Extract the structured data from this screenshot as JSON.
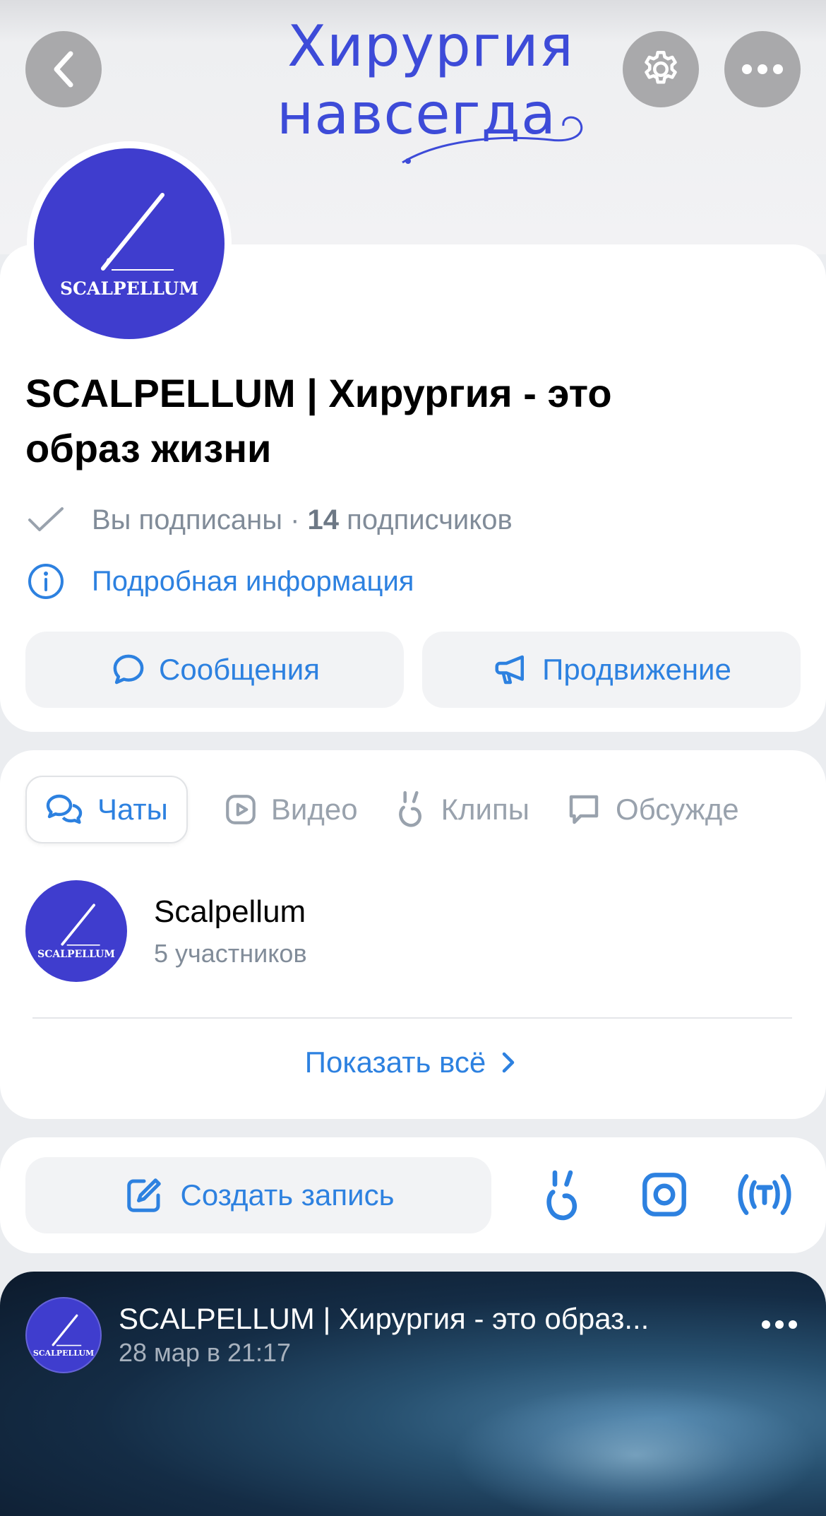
{
  "header": {
    "back_icon": "chevron-left-icon",
    "settings_icon": "gear-icon",
    "more_icon": "more-horizontal-icon",
    "cover_line1": "Хирургия",
    "cover_line2": "навсегда"
  },
  "community": {
    "logo_text": "SCALPELLUM",
    "name_line1": "SCALPELLUM | Хирургия - это",
    "name_line2": "образ жизни",
    "subscribed_text": "Вы подписаны",
    "separator": " · ",
    "subscribers_count": "14",
    "subscribers_label": " подписчиков",
    "info_link": "Подробная информация"
  },
  "actions": {
    "messages_label": "Сообщения",
    "promotion_label": "Продвижение"
  },
  "tabs": [
    {
      "label": "Чаты",
      "icon": "chats-icon",
      "active": true
    },
    {
      "label": "Видео",
      "icon": "video-icon",
      "active": false
    },
    {
      "label": "Клипы",
      "icon": "clips-icon",
      "active": false
    },
    {
      "label": "Обсужде",
      "icon": "discussions-icon",
      "active": false
    }
  ],
  "chat": {
    "logo_text": "SCALPELLUM",
    "name": "Scalpellum",
    "members": "5 участников",
    "show_all": "Показать всё"
  },
  "composer": {
    "create_label": "Создать запись",
    "icons": [
      "clips-icon",
      "instagram-icon",
      "live-stream-icon"
    ]
  },
  "post": {
    "logo_text": "SCALPELLUM",
    "author": "SCALPELLUM | Хирургия - это образ...",
    "date": "28 мар в 21:17",
    "more_icon": "more-horizontal-icon"
  },
  "colors": {
    "accent": "#2d81e0",
    "brand": "#3f3dce",
    "cover_text": "#3d4bd8",
    "secondary_text": "#818c99",
    "background": "#ebedf0"
  }
}
